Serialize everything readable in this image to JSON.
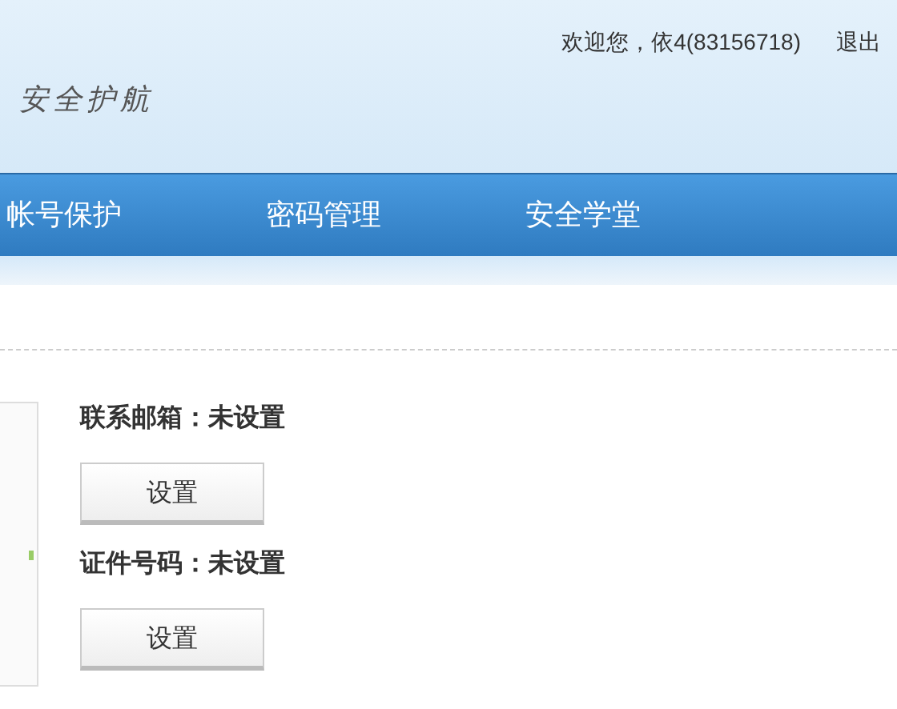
{
  "header": {
    "logo": "安全护航",
    "welcome": "欢迎您，依4(83156718)",
    "logout": "退出"
  },
  "nav": [
    {
      "label": "帐号保护"
    },
    {
      "label": "密码管理"
    },
    {
      "label": "安全学堂"
    }
  ],
  "items": [
    {
      "label": "联系邮箱：未设置",
      "button": "设置"
    },
    {
      "label": "证件号码：未设置",
      "button": "设置"
    }
  ]
}
